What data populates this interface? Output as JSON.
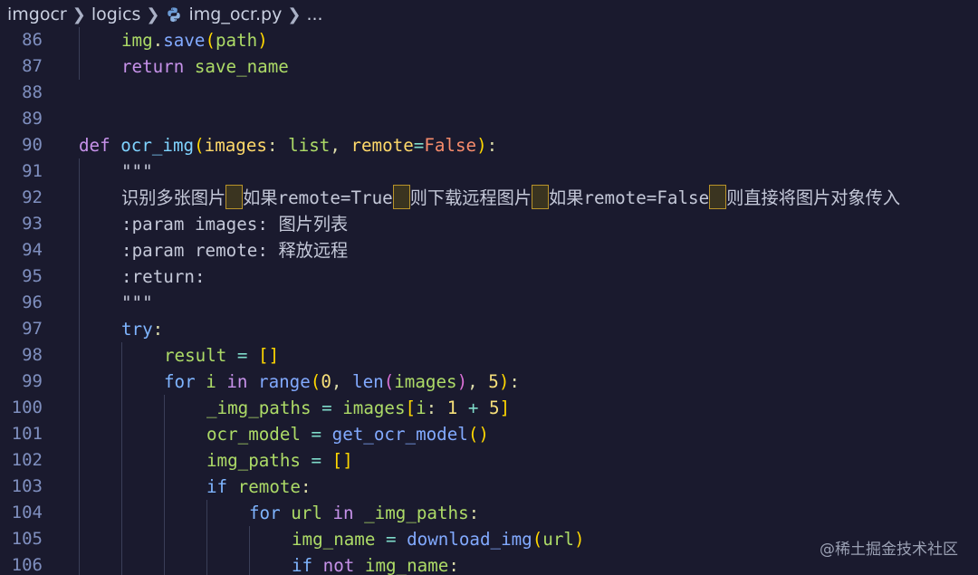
{
  "breadcrumb": {
    "items": [
      "imgocr",
      "logics",
      "img_ocr.py",
      "..."
    ],
    "separator": ">"
  },
  "editor": {
    "lines": [
      {
        "n": "86",
        "text": "    img.save(path)"
      },
      {
        "n": "87",
        "text": "    return save_name"
      },
      {
        "n": "88",
        "text": ""
      },
      {
        "n": "89",
        "text": ""
      },
      {
        "n": "90",
        "text": "def ocr_img(images: list, remote=False):"
      },
      {
        "n": "91",
        "text": "    \"\"\""
      },
      {
        "n": "92",
        "text": "    识别多张图片，如果remote=True，则下载远程图片，如果remote=False，则直接将图片对象传入"
      },
      {
        "n": "93",
        "text": "    :param images: 图片列表"
      },
      {
        "n": "94",
        "text": "    :param remote: 释放远程"
      },
      {
        "n": "95",
        "text": "    :return:"
      },
      {
        "n": "96",
        "text": "    \"\"\""
      },
      {
        "n": "97",
        "text": "    try:"
      },
      {
        "n": "98",
        "text": "        result = []"
      },
      {
        "n": "99",
        "text": "        for i in range(0, len(images), 5):"
      },
      {
        "n": "100",
        "text": "            _img_paths = images[i: 1 + 5]"
      },
      {
        "n": "101",
        "text": "            ocr_model = get_ocr_model()"
      },
      {
        "n": "102",
        "text": "            img_paths = []"
      },
      {
        "n": "103",
        "text": "            if remote:"
      },
      {
        "n": "104",
        "text": "                for url in _img_paths:"
      },
      {
        "n": "105",
        "text": "                    img_name = download_img(url)"
      },
      {
        "n": "106",
        "text": "                    if not img_name:"
      }
    ]
  },
  "watermark": "@稀土掘金技术社区",
  "colors": {
    "background": "#1a1a2e",
    "line_number": "#7f8fbf",
    "keyword": "#c792ea",
    "function": "#82aaff",
    "variable": "#addb67",
    "highlight_border": "#b8932a"
  },
  "icons": {
    "file_icon": "python-icon"
  }
}
